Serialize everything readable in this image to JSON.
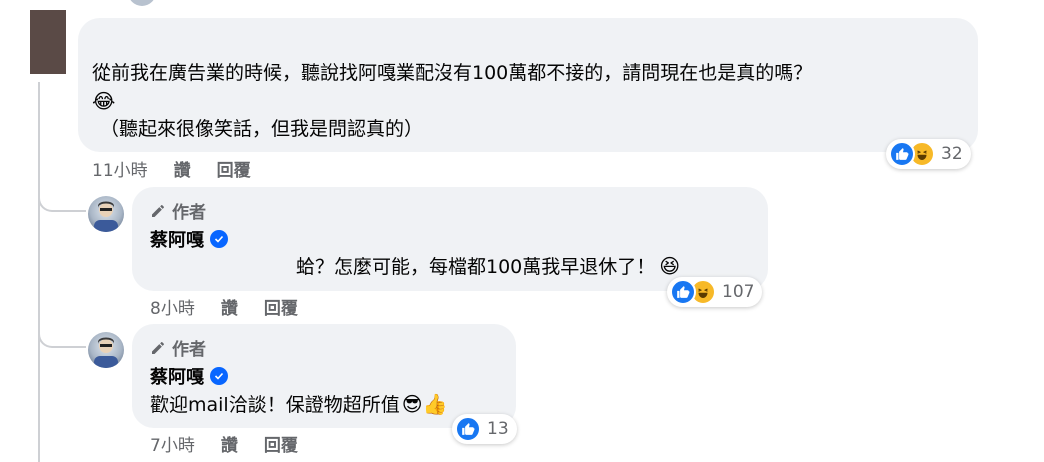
{
  "comments": [
    {
      "text_line1": "從前我在廣告業的時候，聽說找阿嘎業配沒有100萬都不接的，請問現在也是真的嗎？",
      "text_line3": "（聽起來很像笑話，但我是問認真的）",
      "emoji": "😂",
      "time": "11小時",
      "like_label": "讚",
      "reply_label": "回覆",
      "reaction_count": "32"
    }
  ],
  "replies": [
    {
      "author_tag": "作者",
      "author_name": "蔡阿嘎",
      "text": "蛤？怎麼可能，每檔都100萬我早退休了！",
      "emoji": "😆",
      "time": "8小時",
      "like_label": "讚",
      "reply_label": "回覆",
      "reaction_count": "107"
    },
    {
      "author_tag": "作者",
      "author_name": "蔡阿嘎",
      "text": "歡迎mail洽談！保證物超所值",
      "emoji": "😎👍",
      "time": "7小時",
      "like_label": "讚",
      "reply_label": "回覆",
      "reaction_count": "13"
    }
  ],
  "colors": {
    "bubble": "#f0f2f5",
    "meta_text": "#65676b",
    "like_blue": "#1877f2",
    "verified_blue": "#0866ff"
  }
}
